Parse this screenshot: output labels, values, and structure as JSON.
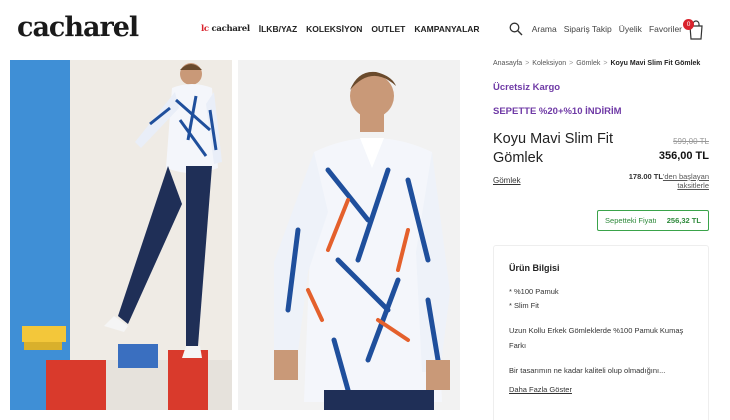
{
  "header": {
    "logo": "cacharel",
    "nav": {
      "brand_lc": "lc",
      "brand_name": "cacharel",
      "items": [
        "İLKB/YAZ",
        "KOLEKSİYON",
        "OUTLET",
        "KAMPANYALAR"
      ]
    },
    "util": {
      "search": "Arama",
      "order_tracking": "Sipariş Takip",
      "account": "Üyelik",
      "favorites": "Favoriler",
      "cart_count": "0"
    }
  },
  "breadcrumb": [
    "Anasayfa",
    "Koleksiyon",
    "Gömlek",
    "Koyu Mavi Slim Fit Gömlek"
  ],
  "product": {
    "promo_shipping": "Ücretsiz Kargo",
    "promo_discount": "SEPETTE %20+%10 İNDİRİM",
    "title": "Koyu Mavi Slim Fit Gömlek",
    "old_price": "599,00 TL",
    "new_price": "356,00 TL",
    "category": "Gömlek",
    "installment_amount": "178.00 TL",
    "installment_text_1": "'den başlayan",
    "installment_text_2": "taksitlerle",
    "basket_label": "Sepetteki Fiyatı",
    "basket_price": "256,32 TL"
  },
  "info": {
    "title": "Ürün Bilgisi",
    "features": [
      "* %100 Pamuk",
      "* Slim Fit"
    ],
    "description": "Uzun Kollu Erkek Gömleklerde %100 Pamuk Kumaş Farkı",
    "teaser": "Bir tasarımın ne kadar kaliteli olup olmadığını...",
    "more": "Daha Fazla Göster"
  },
  "colors": {
    "accent_red": "#d9232d",
    "promo_purple": "#6f3aa6",
    "basket_green": "#3aa34a"
  }
}
